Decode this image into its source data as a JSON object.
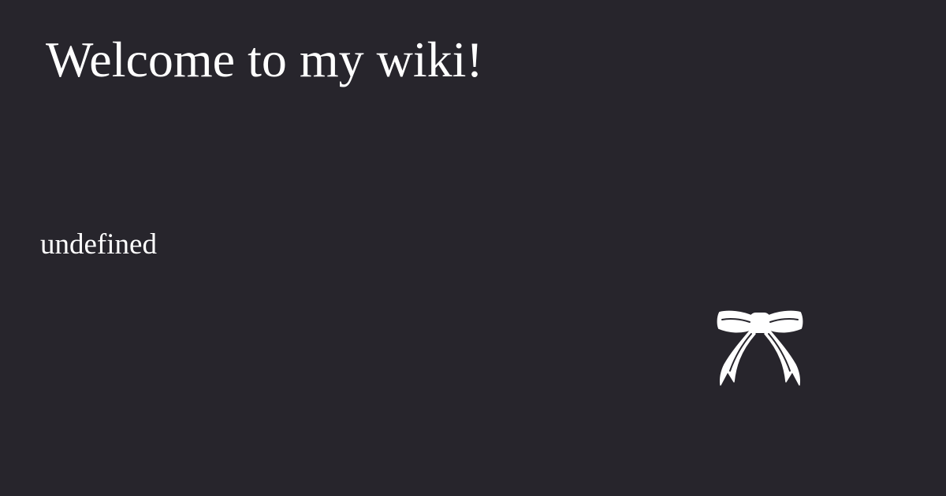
{
  "page": {
    "title": "Welcome to my wiki!",
    "subtitle": "undefined",
    "icon": "bow-icon",
    "colors": {
      "background": "#27252c",
      "text": "#ffffff"
    }
  }
}
